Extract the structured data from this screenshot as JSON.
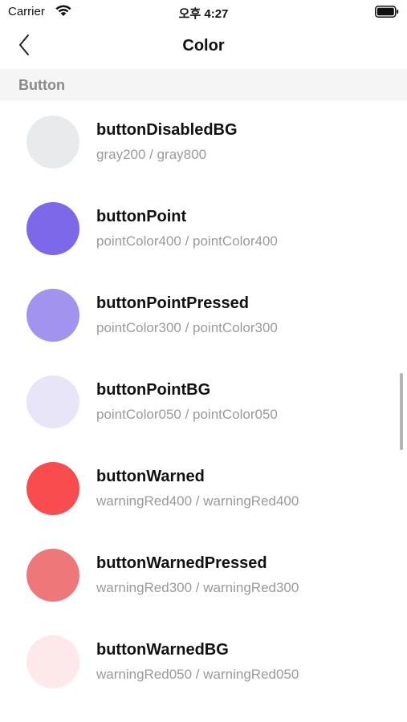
{
  "status_bar": {
    "carrier": "Carrier",
    "time": "오후 4:27",
    "icons": [
      "wifi-icon",
      "battery-icon"
    ]
  },
  "nav": {
    "back_icon": "chevron-left-icon",
    "title": "Color"
  },
  "section": {
    "title": "Button"
  },
  "colors": [
    {
      "name": "buttonDisabledBG",
      "value": "gray200 / gray800",
      "swatch": "#e8eaeb"
    },
    {
      "name": "buttonPoint",
      "value": "pointColor400 / pointColor400",
      "swatch": "#7c68e8"
    },
    {
      "name": "buttonPointPressed",
      "value": "pointColor300 / pointColor300",
      "swatch": "#a294ee"
    },
    {
      "name": "buttonPointBG",
      "value": "pointColor050 / pointColor050",
      "swatch": "#e8e5f9"
    },
    {
      "name": "buttonWarned",
      "value": "warningRed400 / warningRed400",
      "swatch": "#f94c4e"
    },
    {
      "name": "buttonWarnedPressed",
      "value": "warningRed300 / warningRed300",
      "swatch": "#ee777a"
    },
    {
      "name": "buttonWarnedBG",
      "value": "warningRed050 / warningRed050",
      "swatch": "#fde8ea"
    }
  ]
}
